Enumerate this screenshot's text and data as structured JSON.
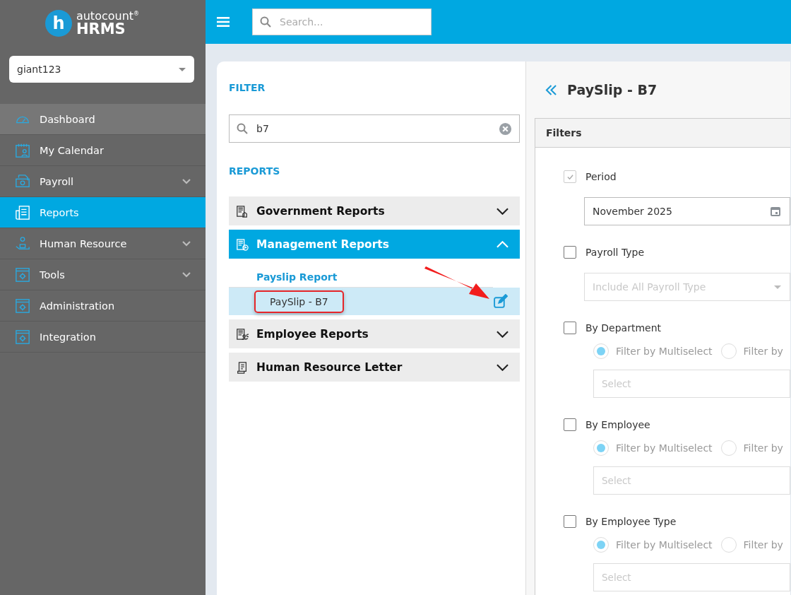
{
  "brand": {
    "mark": "h",
    "top": "autocount",
    "registered": "®",
    "name": "HRMS"
  },
  "topbar": {
    "search_placeholder": "Search..."
  },
  "sidebar": {
    "company": "giant123",
    "items": [
      {
        "label": "Dashboard",
        "kind": "gauge",
        "selected": false,
        "hovered": true,
        "expandable": false
      },
      {
        "label": "My Calendar",
        "kind": "calendar",
        "selected": false,
        "hovered": false,
        "expandable": false
      },
      {
        "label": "Payroll",
        "kind": "money",
        "selected": false,
        "hovered": false,
        "expandable": true
      },
      {
        "label": "Reports",
        "kind": "report",
        "selected": true,
        "hovered": false,
        "expandable": false
      },
      {
        "label": "Human Resource",
        "kind": "person",
        "selected": false,
        "hovered": false,
        "expandable": true
      },
      {
        "label": "Tools",
        "kind": "window",
        "selected": false,
        "hovered": false,
        "expandable": true
      },
      {
        "label": "Administration",
        "kind": "window",
        "selected": false,
        "hovered": false,
        "expandable": false
      },
      {
        "label": "Integration",
        "kind": "window",
        "selected": false,
        "hovered": false,
        "expandable": false
      }
    ]
  },
  "filter_panel": {
    "filter_heading": "FILTER",
    "search_value": "b7",
    "reports_heading": "REPORTS",
    "groups": [
      {
        "label": "Government Reports",
        "kind": "gov",
        "expanded": false
      },
      {
        "label": "Management Reports",
        "kind": "clock",
        "expanded": true,
        "subgroups": [
          {
            "label": "Payslip Report",
            "reports": [
              {
                "label": "PaySlip - B7",
                "selected": true,
                "highlighted": true
              }
            ]
          }
        ]
      },
      {
        "label": "Employee Reports",
        "kind": "people",
        "expanded": false
      },
      {
        "label": "Human Resource Letter",
        "kind": "letter",
        "expanded": false
      }
    ],
    "annotation_arrow": true
  },
  "report": {
    "title": "PaySlip - B7",
    "filters_heading": "Filters",
    "sections": [
      {
        "kind": "date",
        "label": "Period",
        "checked": true,
        "disabled": true,
        "value": "November 2025"
      },
      {
        "kind": "dropdown",
        "label": "Payroll Type",
        "checked": false,
        "disabled": false,
        "placeholder": "Include All Payroll Type"
      },
      {
        "kind": "multiselect",
        "label": "By Department",
        "checked": false,
        "disabled": false,
        "options": [
          {
            "label": "Filter by Multiselect",
            "selected": true
          },
          {
            "label": "Filter by",
            "selected": false
          }
        ],
        "placeholder": "Select"
      },
      {
        "kind": "multiselect",
        "label": "By Employee",
        "checked": false,
        "disabled": false,
        "options": [
          {
            "label": "Filter by Multiselect",
            "selected": true
          },
          {
            "label": "Filter by",
            "selected": false
          }
        ],
        "placeholder": "Select"
      },
      {
        "kind": "multiselect",
        "label": "By Employee Type",
        "checked": false,
        "disabled": false,
        "options": [
          {
            "label": "Filter by Multiselect",
            "selected": true
          },
          {
            "label": "Filter by",
            "selected": false
          }
        ],
        "placeholder": "Select"
      }
    ]
  }
}
